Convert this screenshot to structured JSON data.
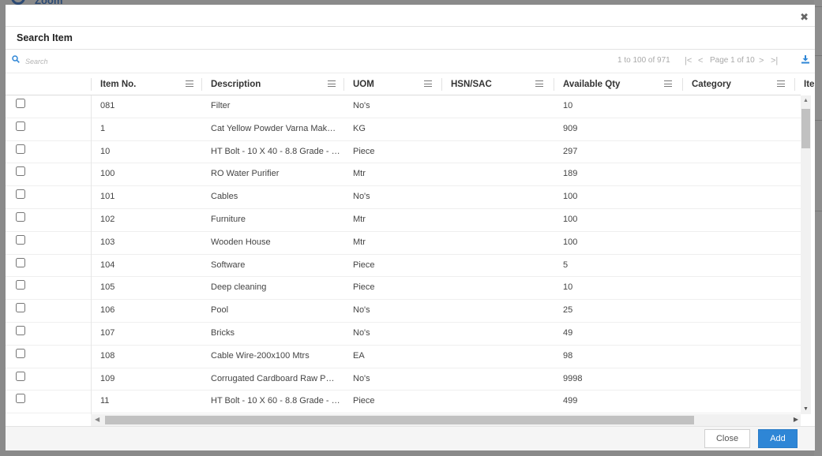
{
  "backdrop": {
    "logo_text": "Zoom"
  },
  "dialog": {
    "title": "Search Item",
    "close_icon": "close-icon"
  },
  "toolbar": {
    "search_placeholder": "Search",
    "pager_summary": "1 to 100 of 971",
    "page_label": "Page 1 of 10",
    "first_glyph": "|<",
    "prev_glyph": "<",
    "next_glyph": ">",
    "last_glyph": ">|",
    "download_icon": "download-icon"
  },
  "columns": [
    {
      "key": "item_no",
      "label": "Item No."
    },
    {
      "key": "description",
      "label": "Description"
    },
    {
      "key": "uom",
      "label": "UOM"
    },
    {
      "key": "hsn",
      "label": "HSN/SAC"
    },
    {
      "key": "qty",
      "label": "Available Qty"
    },
    {
      "key": "category",
      "label": "Category"
    },
    {
      "key": "more",
      "label": "Ite"
    }
  ],
  "rows": [
    {
      "item_no": "081",
      "description": "Filter",
      "uom": "No's",
      "hsn": "",
      "qty": "10",
      "category": ""
    },
    {
      "item_no": "1",
      "description": "Cat Yellow Powder Varna Mak…",
      "uom": "KG",
      "hsn": "",
      "qty": "909",
      "category": ""
    },
    {
      "item_no": "10",
      "description": "HT Bolt - 10 X 40 - 8.8 Grade - …",
      "uom": "Piece",
      "hsn": "",
      "qty": "297",
      "category": ""
    },
    {
      "item_no": "100",
      "description": "RO Water Purifier",
      "uom": "Mtr",
      "hsn": "",
      "qty": "189",
      "category": ""
    },
    {
      "item_no": "101",
      "description": "Cables",
      "uom": "No's",
      "hsn": "",
      "qty": "100",
      "category": ""
    },
    {
      "item_no": "102",
      "description": "Furniture",
      "uom": "Mtr",
      "hsn": "",
      "qty": "100",
      "category": ""
    },
    {
      "item_no": "103",
      "description": "Wooden House",
      "uom": "Mtr",
      "hsn": "",
      "qty": "100",
      "category": ""
    },
    {
      "item_no": "104",
      "description": "Software",
      "uom": "Piece",
      "hsn": "",
      "qty": "5",
      "category": ""
    },
    {
      "item_no": "105",
      "description": "Deep cleaning",
      "uom": "Piece",
      "hsn": "",
      "qty": "10",
      "category": ""
    },
    {
      "item_no": "106",
      "description": "Pool",
      "uom": "No's",
      "hsn": "",
      "qty": "25",
      "category": ""
    },
    {
      "item_no": "107",
      "description": "Bricks",
      "uom": "No's",
      "hsn": "",
      "qty": "49",
      "category": ""
    },
    {
      "item_no": "108",
      "description": "Cable Wire-200x100 Mtrs",
      "uom": "EA",
      "hsn": "",
      "qty": "98",
      "category": ""
    },
    {
      "item_no": "109",
      "description": "Corrugated Cardboard Raw P…",
      "uom": "No's",
      "hsn": "",
      "qty": "9998",
      "category": ""
    },
    {
      "item_no": "11",
      "description": "HT Bolt - 10 X 60 - 8.8 Grade - …",
      "uom": "Piece",
      "hsn": "",
      "qty": "499",
      "category": ""
    },
    {
      "item_no": "",
      "description": "",
      "uom": "",
      "hsn": "",
      "qty": "",
      "category": ""
    }
  ],
  "footer": {
    "close_label": "Close",
    "add_label": "Add"
  },
  "colors": {
    "accent": "#2e86d6",
    "header_text": "#333333",
    "cell_text": "#444444"
  }
}
